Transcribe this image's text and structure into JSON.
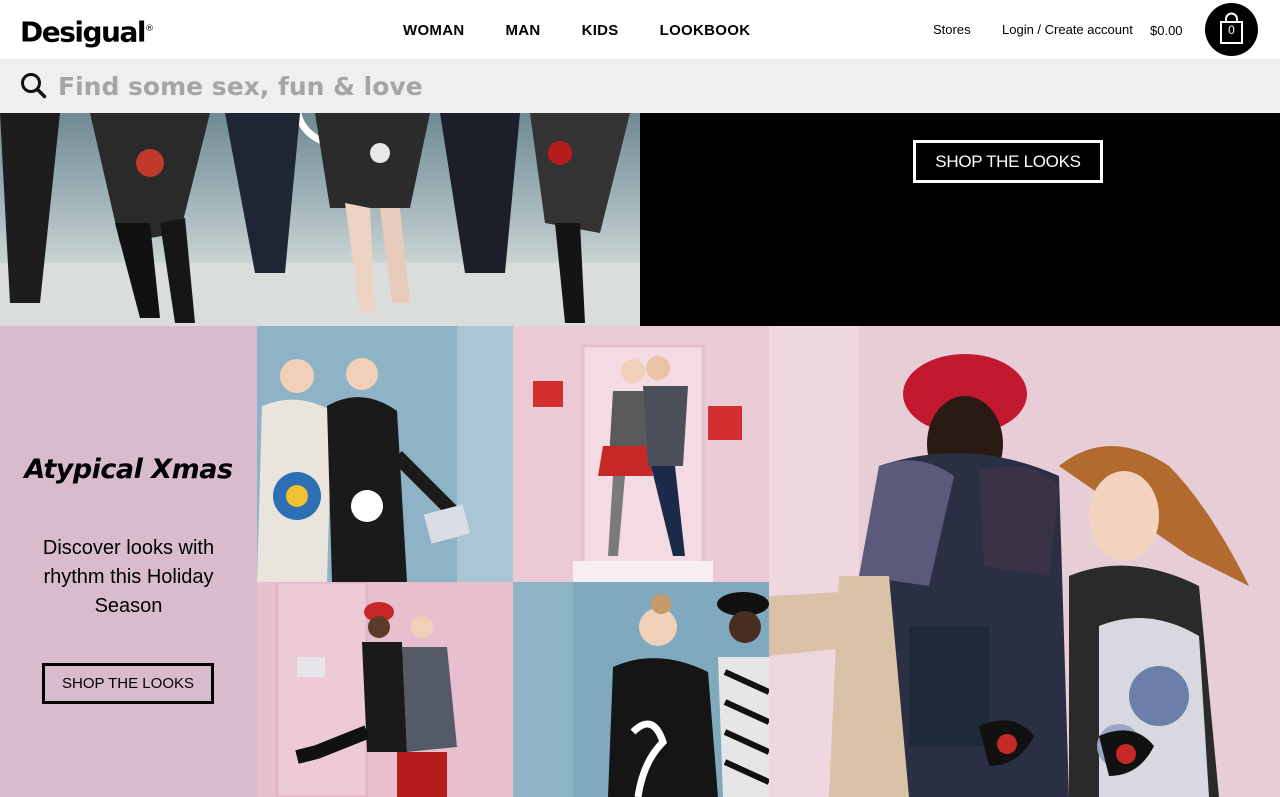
{
  "header": {
    "logo": "Desigual",
    "logo_mark": "®",
    "nav": [
      "WOMAN",
      "MAN",
      "KIDS",
      "LOOKBOOK"
    ],
    "stores": "Stores",
    "login": "Login / Create account",
    "cart_total": "$0.00",
    "cart_count": "0"
  },
  "search": {
    "placeholder": "Find some sex, fun & love"
  },
  "hero": {
    "cta": "SHOP THE LOOKS"
  },
  "promo": {
    "title": "Atypical Xmas",
    "text": "Discover looks with rhythm this Holiday Season",
    "cta": "SHOP THE LOOKS"
  },
  "colors": {
    "promo_bg": "#d8bccd",
    "search_bg": "#efefef",
    "hero_right_bg": "#000000"
  },
  "icons": [
    "search-icon",
    "shopping-bag-icon"
  ]
}
